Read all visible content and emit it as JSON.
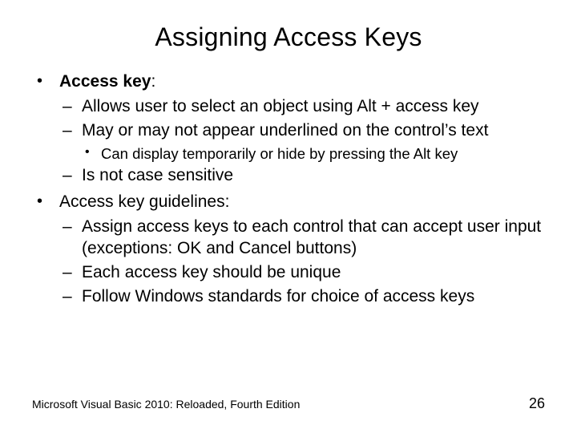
{
  "title": "Assigning Access Keys",
  "bullets": {
    "b1_label": "Access key",
    "b1_colon": ":",
    "b1_sub1": "Allows user to select an object using Alt + access key",
    "b1_sub2": "May or may not appear underlined on the control’s text",
    "b1_sub2_sub1": "Can display temporarily or hide by pressing the Alt key",
    "b1_sub3": "Is not case sensitive",
    "b2_label": "Access key guidelines:",
    "b2_sub1": "Assign access keys to each control that can accept user input (exceptions: OK and Cancel buttons)",
    "b2_sub2": "Each access key should be unique",
    "b2_sub3": "Follow Windows standards for choice of access keys"
  },
  "footer": {
    "source": "Microsoft Visual Basic 2010: Reloaded, Fourth Edition",
    "page": "26"
  }
}
